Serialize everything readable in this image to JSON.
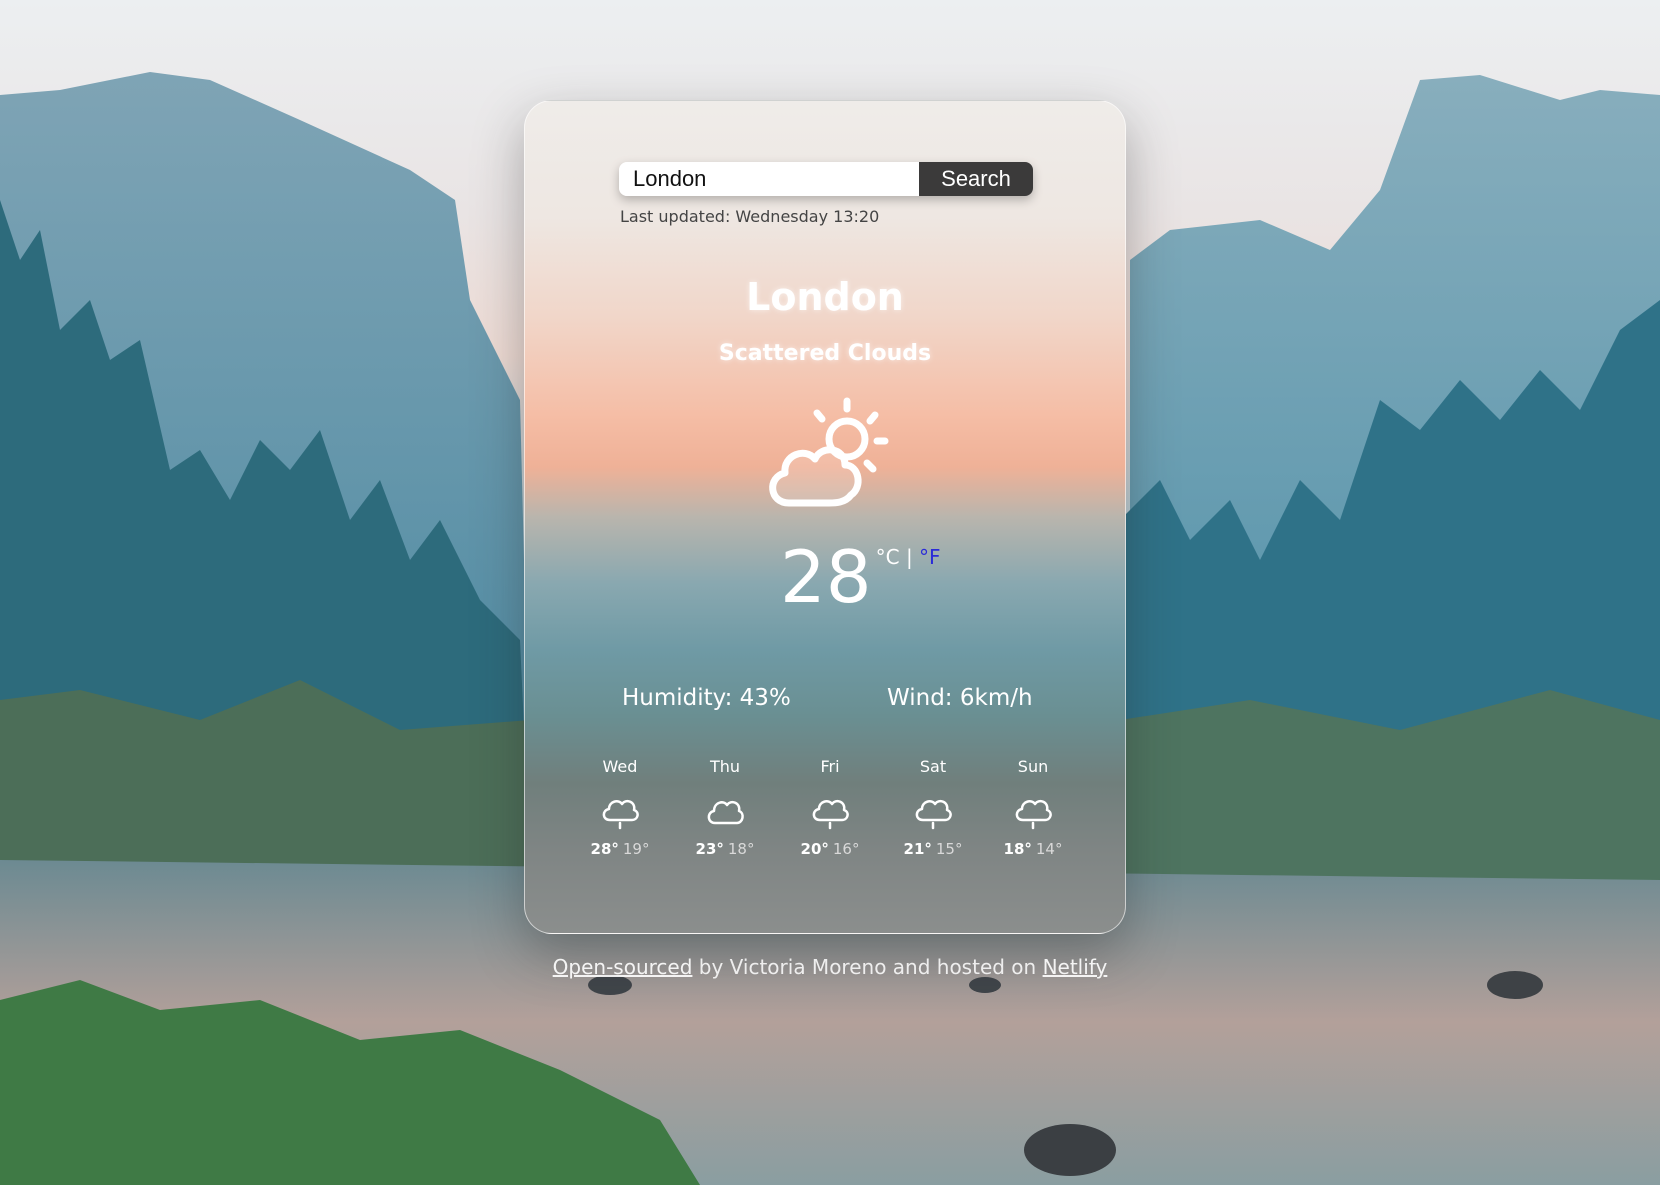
{
  "search": {
    "value": "London",
    "button_label": "Search"
  },
  "last_updated": "Last updated: Wednesday 13:20",
  "weather": {
    "city": "London",
    "description": "Scattered Clouds",
    "icon": "partly-cloudy-icon",
    "temperature": "28",
    "unit_c": "°C",
    "separator": " | ",
    "unit_f": "°F",
    "humidity": "Humidity: 43%",
    "wind": "Wind: 6km/h"
  },
  "forecast": [
    {
      "day": "Wed",
      "max": "28°",
      "min": "19°",
      "icon": "rain-cloud-icon"
    },
    {
      "day": "Thu",
      "max": "23°",
      "min": "18°",
      "icon": "cloud-icon"
    },
    {
      "day": "Fri",
      "max": "20°",
      "min": "16°",
      "icon": "rain-cloud-icon"
    },
    {
      "day": "Sat",
      "max": "21°",
      "min": "15°",
      "icon": "rain-cloud-icon"
    },
    {
      "day": "Sun",
      "max": "18°",
      "min": "14°",
      "icon": "rain-cloud-icon"
    }
  ],
  "footer": {
    "link1": "Open-sourced",
    "middle": " by Victoria Moreno and hosted on ",
    "link2": "Netlify"
  },
  "colors": {
    "button_bg": "#3b3a3a",
    "fahrenheit_link": "#2a2bd8"
  }
}
